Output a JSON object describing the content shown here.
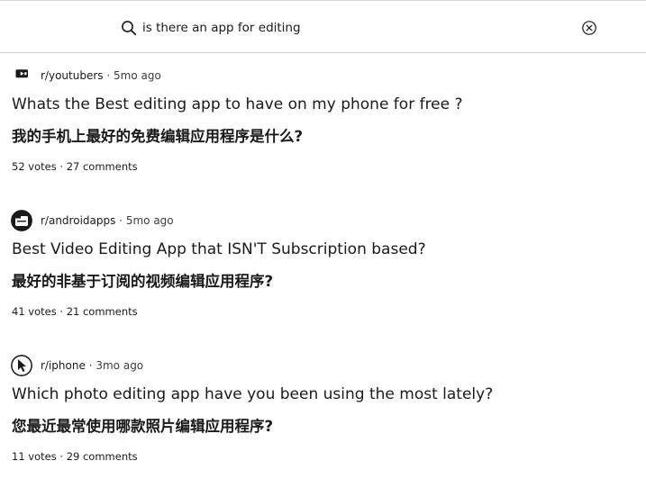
{
  "search": {
    "query": "is there an app for editing",
    "icon": "search-icon",
    "clear_icon": "close-circle-icon"
  },
  "posts": [
    {
      "subreddit": "r/youtubers",
      "separator": "·",
      "age": "5mo ago",
      "avatar_icon": "youtube-play-icon",
      "title": "Whats the Best editing app to have on my phone for free ?",
      "translation": "我的手机上最好的免费编辑应用程序是什么?",
      "votes": "52 votes",
      "comments": "27 comments"
    },
    {
      "subreddit": "r/androidapps",
      "separator": "·",
      "age": "5mo ago",
      "avatar_icon": "apps-folder-icon",
      "title": "Best Video Editing App that ISN'T Subscription based?",
      "translation": "最好的非基于订阅的视频编辑应用程序?",
      "votes": "41 votes",
      "comments": "21 comments"
    },
    {
      "subreddit": "r/iphone",
      "separator": "·",
      "age": "3mo ago",
      "avatar_icon": "iphone-cursor-icon",
      "title": "Which photo editing app have you been using the most lately?",
      "translation": "您最近最常使用哪款照片编辑应用程序?",
      "votes": "11 votes",
      "comments": "29 comments"
    }
  ]
}
